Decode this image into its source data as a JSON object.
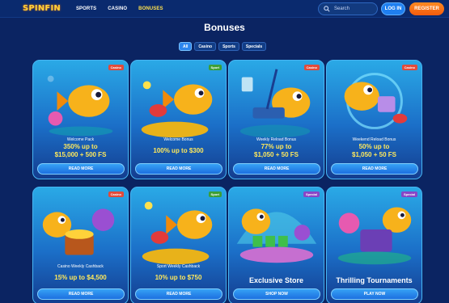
{
  "header": {
    "logo": "SPINFIN",
    "nav": [
      "SPORTS",
      "CASINO",
      "BONUSES"
    ],
    "search_placeholder": "Search",
    "login": "LOG IN",
    "register": "REGISTER"
  },
  "page": {
    "title": "Bonuses",
    "filters": [
      "All",
      "Casino",
      "Sports",
      "Specials"
    ]
  },
  "cards": [
    {
      "badge": "Casino",
      "subtitle": "Welcome Pack",
      "offer_line1": "350% up to",
      "offer_line2": "$15,000 + 500 FS",
      "cta": "READ MORE"
    },
    {
      "badge": "Sport",
      "subtitle": "Welcome Bonus",
      "offer_line1": "100% up to $300",
      "offer_line2": "",
      "cta": "READ MORE"
    },
    {
      "badge": "Casino",
      "subtitle": "Weekly Reload Bonus",
      "offer_line1": "77% up to",
      "offer_line2": "$1,050 + 50 FS",
      "cta": "READ MORE"
    },
    {
      "badge": "Casino",
      "subtitle": "Weekend Reload Bonus",
      "offer_line1": "50% up to",
      "offer_line2": "$1,050 + 50 FS",
      "cta": "READ MORE"
    },
    {
      "badge": "Casino",
      "subtitle": "Casino Weekly Cashback",
      "offer_line1": "15% up to $4,500",
      "offer_line2": "",
      "cta": "READ MORE"
    },
    {
      "badge": "Sport",
      "subtitle": "Sport Weekly Cashback",
      "offer_line1": "10% up to $750",
      "offer_line2": "",
      "cta": "READ MORE"
    },
    {
      "badge": "Special",
      "subtitle": "",
      "offer_line1": "Exclusive Store",
      "offer_line2": "",
      "cta": "SHOP NOW"
    },
    {
      "badge": "Special",
      "subtitle": "",
      "offer_line1": "Thrilling Tournaments",
      "offer_line2": "",
      "cta": "PLAY NOW"
    }
  ],
  "colors": {
    "background": "#0b2462",
    "accent_yellow": "#ffe95c",
    "login_blue": "#1f7ff0",
    "register_orange": "#f25b0d"
  }
}
